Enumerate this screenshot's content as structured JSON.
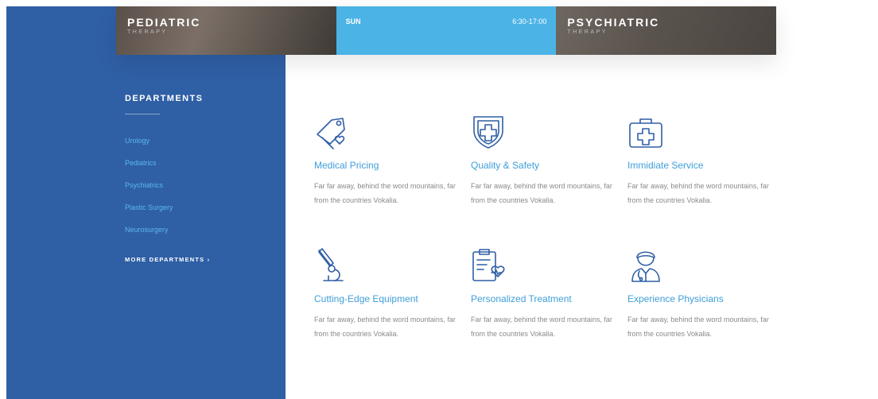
{
  "cards": [
    {
      "title": "PEDIATRIC",
      "subtitle": "THERAPY"
    },
    {
      "day": "SUN",
      "time": "6:30-17:00"
    },
    {
      "title": "PSYCHIATRIC",
      "subtitle": "THERAPY"
    }
  ],
  "departments": {
    "heading": "DEPARTMENTS",
    "items": [
      "Urology",
      "Pediatrics",
      "Psychiatrics",
      "Plastic Surgery",
      "Neurosurgery"
    ],
    "more_label": "MORE DEPARTMENTS ›"
  },
  "features": [
    {
      "title": "Medical Pricing",
      "desc": "Far far away, behind the word mountains, far from the countries Vokalia.",
      "icon": "price-tag-heart-icon"
    },
    {
      "title": "Quality & Safety",
      "desc": "Far far away, behind the word mountains, far from the countries Vokalia.",
      "icon": "shield-cross-icon"
    },
    {
      "title": "Immidiate Service",
      "desc": "Far far away, behind the word mountains, far from the countries Vokalia.",
      "icon": "medical-kit-icon"
    },
    {
      "title": "Cutting-Edge Equipment",
      "desc": "Far far away, behind the word mountains, far from the countries Vokalia.",
      "icon": "microscope-icon"
    },
    {
      "title": "Personalized Treatment",
      "desc": "Far far away, behind the word mountains, far from the countries Vokalia.",
      "icon": "clipboard-heart-icon"
    },
    {
      "title": "Experience Physicians",
      "desc": "Far far away, behind the word mountains, far from the countries Vokalia.",
      "icon": "doctor-icon"
    }
  ],
  "colors": {
    "panel": "#2f5fa5",
    "accent": "#4bb3e6",
    "link": "#3f9fd9",
    "icon": "#2f5fa5"
  }
}
